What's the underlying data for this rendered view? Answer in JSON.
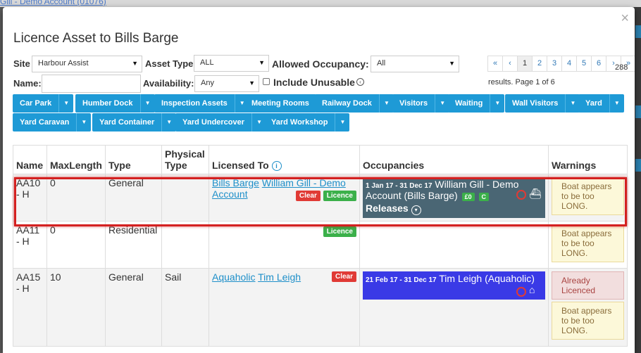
{
  "backdrop": {
    "link_text": "Gill - Demo Account (01076)"
  },
  "modal": {
    "title": "Licence Asset to Bills Barge",
    "close_glyph": "×"
  },
  "filters": {
    "site_label": "Site",
    "site_value": "Harbour Assist",
    "asset_type_label": "Asset Type",
    "asset_type_value": "ALL",
    "allowed_occupancy_label": "Allowed Occupancy:",
    "allowed_occupancy_value": "All",
    "name_label": "Name:",
    "name_value": "",
    "availability_label": "Availability:",
    "availability_value": "Any",
    "include_unusable_label": "Include Unusable"
  },
  "pagination": {
    "pages": [
      "«",
      "‹",
      "1",
      "2",
      "3",
      "4",
      "5",
      "6",
      "›",
      "»"
    ],
    "total": "288",
    "info": "results. Page 1 of 6"
  },
  "asset_filters": [
    "Car Park",
    "Humber Dock",
    "Inspection Assets",
    "Meeting Rooms",
    "Railway Dock",
    "Visitors",
    "Waiting",
    "Wall Visitors",
    "Yard",
    "Yard Caravan",
    "Yard Container",
    "Yard Undercover",
    "Yard Workshop"
  ],
  "table": {
    "headers": [
      "Name",
      "MaxLength",
      "Type",
      "Physical Type",
      "Licensed To",
      "Occupancies",
      "Warnings"
    ],
    "rows": [
      {
        "name": "AA10 - H",
        "max_length": "0",
        "type": "General",
        "physical_type": "",
        "licensed_links": [
          "Bills Barge",
          "William Gill - Demo Account"
        ],
        "clear_label": "Clear",
        "licence_label": "Licence",
        "occupancy": {
          "dates": "1 Jan 17 - 31 Dec 17",
          "holder": "William Gill - Demo Account (Bills Barge)",
          "tags": [
            "£0",
            "C"
          ],
          "releases": "Releases",
          "color": "#4a6674"
        },
        "warnings": [
          "Boat appears to be too LONG."
        ]
      },
      {
        "name": "AA11 - H",
        "max_length": "0",
        "type": "Residential",
        "physical_type": "",
        "licensed_links": [],
        "licence_label": "Licence",
        "warnings": [
          "Boat appears to be too LONG."
        ]
      },
      {
        "name": "AA15 - H",
        "max_length": "10",
        "type": "General",
        "physical_type": "Sail",
        "licensed_links": [
          "Aquaholic",
          "Tim Leigh"
        ],
        "clear_label": "Clear",
        "occupancy": {
          "dates": "21 Feb 17 - 31 Dec 17",
          "holder": "Tim Leigh (Aquaholic)",
          "color": "#3a3ae6"
        },
        "warnings": [
          "Already Licenced",
          "Boat appears to be too LONG."
        ]
      }
    ]
  },
  "colors": {
    "primary_button": "#1e9ad6",
    "danger": "#e03a35",
    "success": "#3bb04a",
    "highlight": "#d42020"
  }
}
